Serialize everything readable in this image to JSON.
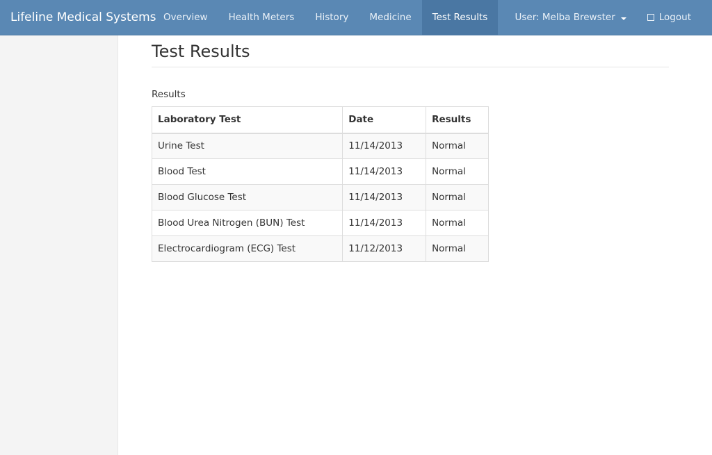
{
  "navbar": {
    "brand": "Lifeline Medical Systems",
    "items": [
      {
        "label": "Overview"
      },
      {
        "label": "Health Meters"
      },
      {
        "label": "History"
      },
      {
        "label": "Medicine"
      },
      {
        "label": "Test Results"
      }
    ],
    "active_item": "Test Results",
    "user_label": "User: Melba Brewster",
    "logout_label": "Logout",
    "bg_color": "#5a88b4"
  },
  "main": {
    "title": "Test Results",
    "section_label": "Results",
    "table": {
      "headers": [
        "Laboratory Test",
        "Date",
        "Results"
      ],
      "rows": [
        [
          "Urine Test",
          "11/14/2013",
          "Normal"
        ],
        [
          "Blood Test",
          "11/14/2013",
          "Normal"
        ],
        [
          "Blood Glucose Test",
          "11/14/2013",
          "Normal"
        ],
        [
          "Blood Urea Nitrogen (BUN) Test",
          "11/14/2013",
          "Normal"
        ],
        [
          "Electrocardiogram (ECG) Test",
          "11/12/2013",
          "Normal"
        ]
      ]
    }
  }
}
